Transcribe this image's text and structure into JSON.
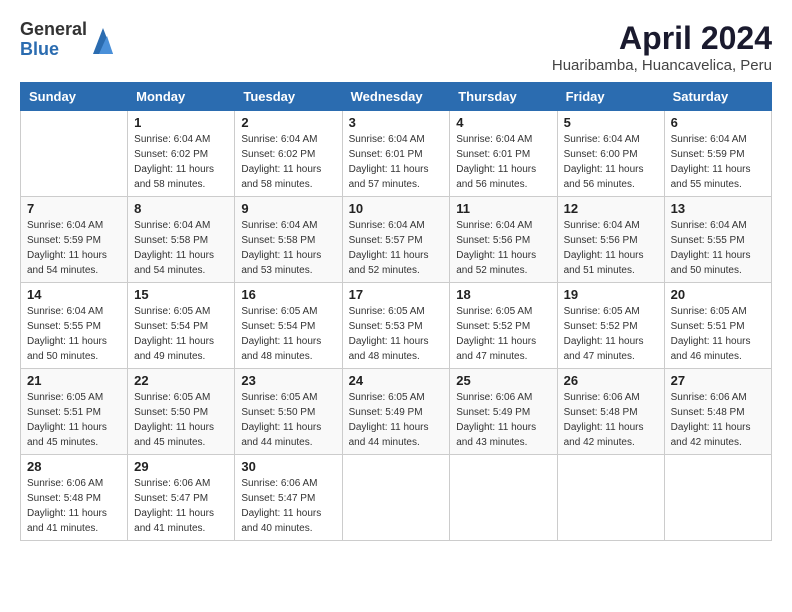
{
  "logo": {
    "general": "General",
    "blue": "Blue"
  },
  "title": "April 2024",
  "subtitle": "Huaribamba, Huancavelica, Peru",
  "weekdays": [
    "Sunday",
    "Monday",
    "Tuesday",
    "Wednesday",
    "Thursday",
    "Friday",
    "Saturday"
  ],
  "weeks": [
    [
      {
        "day": "",
        "info": ""
      },
      {
        "day": "1",
        "info": "Sunrise: 6:04 AM\nSunset: 6:02 PM\nDaylight: 11 hours\nand 58 minutes."
      },
      {
        "day": "2",
        "info": "Sunrise: 6:04 AM\nSunset: 6:02 PM\nDaylight: 11 hours\nand 58 minutes."
      },
      {
        "day": "3",
        "info": "Sunrise: 6:04 AM\nSunset: 6:01 PM\nDaylight: 11 hours\nand 57 minutes."
      },
      {
        "day": "4",
        "info": "Sunrise: 6:04 AM\nSunset: 6:01 PM\nDaylight: 11 hours\nand 56 minutes."
      },
      {
        "day": "5",
        "info": "Sunrise: 6:04 AM\nSunset: 6:00 PM\nDaylight: 11 hours\nand 56 minutes."
      },
      {
        "day": "6",
        "info": "Sunrise: 6:04 AM\nSunset: 5:59 PM\nDaylight: 11 hours\nand 55 minutes."
      }
    ],
    [
      {
        "day": "7",
        "info": "Sunrise: 6:04 AM\nSunset: 5:59 PM\nDaylight: 11 hours\nand 54 minutes."
      },
      {
        "day": "8",
        "info": "Sunrise: 6:04 AM\nSunset: 5:58 PM\nDaylight: 11 hours\nand 54 minutes."
      },
      {
        "day": "9",
        "info": "Sunrise: 6:04 AM\nSunset: 5:58 PM\nDaylight: 11 hours\nand 53 minutes."
      },
      {
        "day": "10",
        "info": "Sunrise: 6:04 AM\nSunset: 5:57 PM\nDaylight: 11 hours\nand 52 minutes."
      },
      {
        "day": "11",
        "info": "Sunrise: 6:04 AM\nSunset: 5:56 PM\nDaylight: 11 hours\nand 52 minutes."
      },
      {
        "day": "12",
        "info": "Sunrise: 6:04 AM\nSunset: 5:56 PM\nDaylight: 11 hours\nand 51 minutes."
      },
      {
        "day": "13",
        "info": "Sunrise: 6:04 AM\nSunset: 5:55 PM\nDaylight: 11 hours\nand 50 minutes."
      }
    ],
    [
      {
        "day": "14",
        "info": "Sunrise: 6:04 AM\nSunset: 5:55 PM\nDaylight: 11 hours\nand 50 minutes."
      },
      {
        "day": "15",
        "info": "Sunrise: 6:05 AM\nSunset: 5:54 PM\nDaylight: 11 hours\nand 49 minutes."
      },
      {
        "day": "16",
        "info": "Sunrise: 6:05 AM\nSunset: 5:54 PM\nDaylight: 11 hours\nand 48 minutes."
      },
      {
        "day": "17",
        "info": "Sunrise: 6:05 AM\nSunset: 5:53 PM\nDaylight: 11 hours\nand 48 minutes."
      },
      {
        "day": "18",
        "info": "Sunrise: 6:05 AM\nSunset: 5:52 PM\nDaylight: 11 hours\nand 47 minutes."
      },
      {
        "day": "19",
        "info": "Sunrise: 6:05 AM\nSunset: 5:52 PM\nDaylight: 11 hours\nand 47 minutes."
      },
      {
        "day": "20",
        "info": "Sunrise: 6:05 AM\nSunset: 5:51 PM\nDaylight: 11 hours\nand 46 minutes."
      }
    ],
    [
      {
        "day": "21",
        "info": "Sunrise: 6:05 AM\nSunset: 5:51 PM\nDaylight: 11 hours\nand 45 minutes."
      },
      {
        "day": "22",
        "info": "Sunrise: 6:05 AM\nSunset: 5:50 PM\nDaylight: 11 hours\nand 45 minutes."
      },
      {
        "day": "23",
        "info": "Sunrise: 6:05 AM\nSunset: 5:50 PM\nDaylight: 11 hours\nand 44 minutes."
      },
      {
        "day": "24",
        "info": "Sunrise: 6:05 AM\nSunset: 5:49 PM\nDaylight: 11 hours\nand 44 minutes."
      },
      {
        "day": "25",
        "info": "Sunrise: 6:06 AM\nSunset: 5:49 PM\nDaylight: 11 hours\nand 43 minutes."
      },
      {
        "day": "26",
        "info": "Sunrise: 6:06 AM\nSunset: 5:48 PM\nDaylight: 11 hours\nand 42 minutes."
      },
      {
        "day": "27",
        "info": "Sunrise: 6:06 AM\nSunset: 5:48 PM\nDaylight: 11 hours\nand 42 minutes."
      }
    ],
    [
      {
        "day": "28",
        "info": "Sunrise: 6:06 AM\nSunset: 5:48 PM\nDaylight: 11 hours\nand 41 minutes."
      },
      {
        "day": "29",
        "info": "Sunrise: 6:06 AM\nSunset: 5:47 PM\nDaylight: 11 hours\nand 41 minutes."
      },
      {
        "day": "30",
        "info": "Sunrise: 6:06 AM\nSunset: 5:47 PM\nDaylight: 11 hours\nand 40 minutes."
      },
      {
        "day": "",
        "info": ""
      },
      {
        "day": "",
        "info": ""
      },
      {
        "day": "",
        "info": ""
      },
      {
        "day": "",
        "info": ""
      }
    ]
  ]
}
